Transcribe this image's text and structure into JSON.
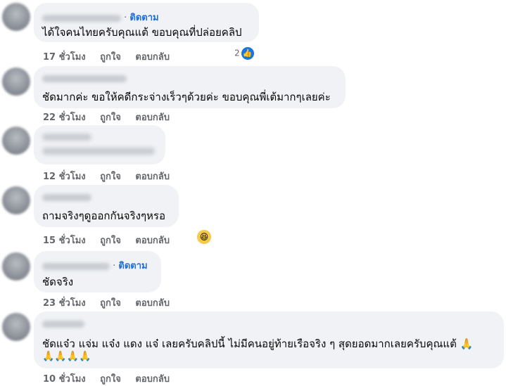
{
  "comments": [
    {
      "follow_label": "ติดตาม",
      "text": "ได้ใจคนไทยครับคุณแต้ ขอบคุณที่ปล่อยคลิป",
      "time": "17 ชั่วโมง",
      "like": "ถูกใจ",
      "reply": "ตอบกลับ",
      "reaction_count": "2",
      "reaction_icon": "like-icon"
    },
    {
      "text": "ชัดมากค่ะ ขอให้คดีกระจ่างเร็วๆด้วยค่ะ ขอบคุณพี่เต้มากๆเลยค่ะ",
      "time": "22 ชั่วโมง",
      "like": "ถูกใจ",
      "reply": "ตอบกลับ"
    },
    {
      "text": "",
      "time": "12 ชั่วโมง",
      "like": "ถูกใจ",
      "reply": "ตอบกลับ"
    },
    {
      "text": "ถามจริงๆดูออกกันจริงๆหรอ",
      "time": "15 ชั่วโมง",
      "like": "ถูกใจ",
      "reply": "ตอบกลับ",
      "reaction_icon": "haha-icon"
    },
    {
      "follow_label": "ติดตาม",
      "text": "ชัดจริง",
      "time": "23 ชั่วโมง",
      "like": "ถูกใจ",
      "reply": "ตอบกลับ"
    },
    {
      "text": "ชัดแจ๋ว แจ่ม แจ๋ง แดง แจ๋ เลยครับคลิปนี้ ไม่มีคนอยู่ท้ายเรือจริง ๆ สุดยอดมากเลยครับคุณแต้ 🙏",
      "text2": "🙏🙏🙏🙏",
      "time": "10 ชั่วโมง",
      "like": "ถูกใจ",
      "reply": "ตอบกลับ"
    }
  ],
  "colors": {
    "bubble": "#f0f2f5",
    "follow": "#216fdb",
    "meta": "#65676b",
    "like": "#1b74e4"
  }
}
